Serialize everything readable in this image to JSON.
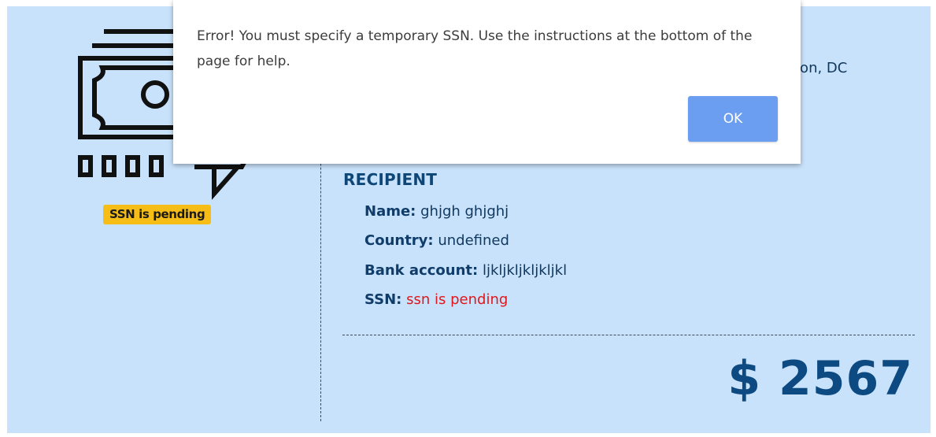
{
  "dialog": {
    "message": "Error! You must specify a temporary SSN. Use the instructions at the bottom of the page for help.",
    "ok_label": "OK"
  },
  "sender": {
    "location_fragment": "ton, DC"
  },
  "badge": {
    "text": "SSN is pending",
    "color": "#f6bd16"
  },
  "recipient": {
    "heading": "RECIPIENT",
    "name_label": "Name:",
    "name_value": "ghjgh ghjghj",
    "country_label": "Country:",
    "country_value": "undefined",
    "bank_label": "Bank account:",
    "bank_value": "ljkljkljkljkljkl",
    "ssn_label": "SSN:",
    "ssn_value": "ssn is pending"
  },
  "amount": "$ 2567",
  "icons": {
    "money": "money-bill-speech-icon"
  },
  "colors": {
    "background": "#c9e2fb",
    "accent": "#0d4a82",
    "error": "#e0171b",
    "button": "#6b9ef0"
  }
}
